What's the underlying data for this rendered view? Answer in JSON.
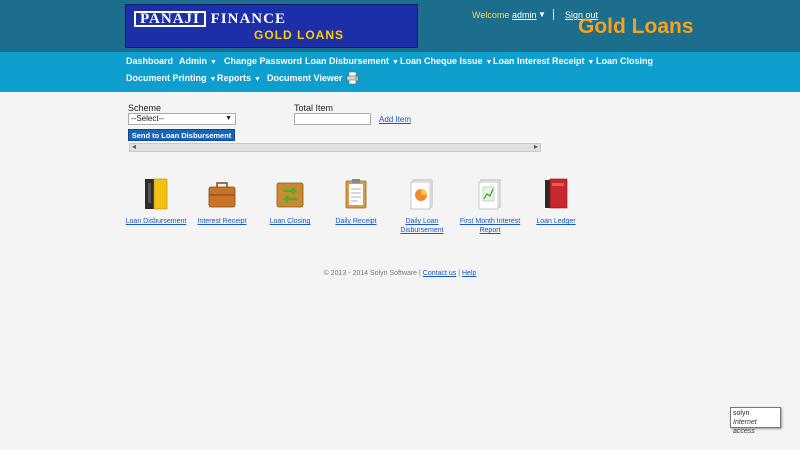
{
  "header": {
    "logo_line1_a": "PANAJI",
    "logo_line1_b": "FINANCE",
    "logo_line2": "GOLD LOANS",
    "welcome": "Welcome",
    "user": "admin",
    "signout": "Sign out",
    "brand": "Gold Loans"
  },
  "nav": {
    "items": [
      {
        "label": "Dashboard"
      },
      {
        "label": "Admin"
      },
      {
        "label": "Change Password"
      },
      {
        "label": "Loan Disbursement"
      },
      {
        "label": "Loan Cheque Issue"
      },
      {
        "label": "Loan Interest Receipt"
      },
      {
        "label": "Loan Closing"
      },
      {
        "label": "Document Printing"
      },
      {
        "label": "Reports"
      },
      {
        "label": "Document Viewer"
      }
    ]
  },
  "form": {
    "scheme_label": "Scheme",
    "scheme_value": "--Select--",
    "total_item_label": "Total Item",
    "total_item_value": "",
    "add_item": "Add Item",
    "send_button": "Send to Loan Disbursement"
  },
  "tiles": [
    {
      "label": "Loan Disbursement",
      "icon": "binder-icon"
    },
    {
      "label": "Interest Receipt",
      "icon": "briefcase-icon"
    },
    {
      "label": "Loan Closing",
      "icon": "box-arrows-icon"
    },
    {
      "label": "Daily Receipt",
      "icon": "clipboard-icon"
    },
    {
      "label": "Daily Loan Disbursement",
      "icon": "pie-report-icon"
    },
    {
      "label": "First Month Interest Report",
      "icon": "chart-report-icon"
    },
    {
      "label": "Loan Ledger",
      "icon": "books-icon"
    }
  ],
  "footer": {
    "copyright": "© 2013 - 2014 Solyn Software |",
    "contact": "Contact us",
    "divider": "|",
    "help": "Help"
  },
  "badge": {
    "line1": "solyn",
    "line2": "Internet access"
  },
  "colors": {
    "topbar": "#1c6e8c",
    "nav": "#0f9fcf",
    "brand": "#f6a21a",
    "link": "#1a56c4",
    "button": "#1864b8"
  }
}
